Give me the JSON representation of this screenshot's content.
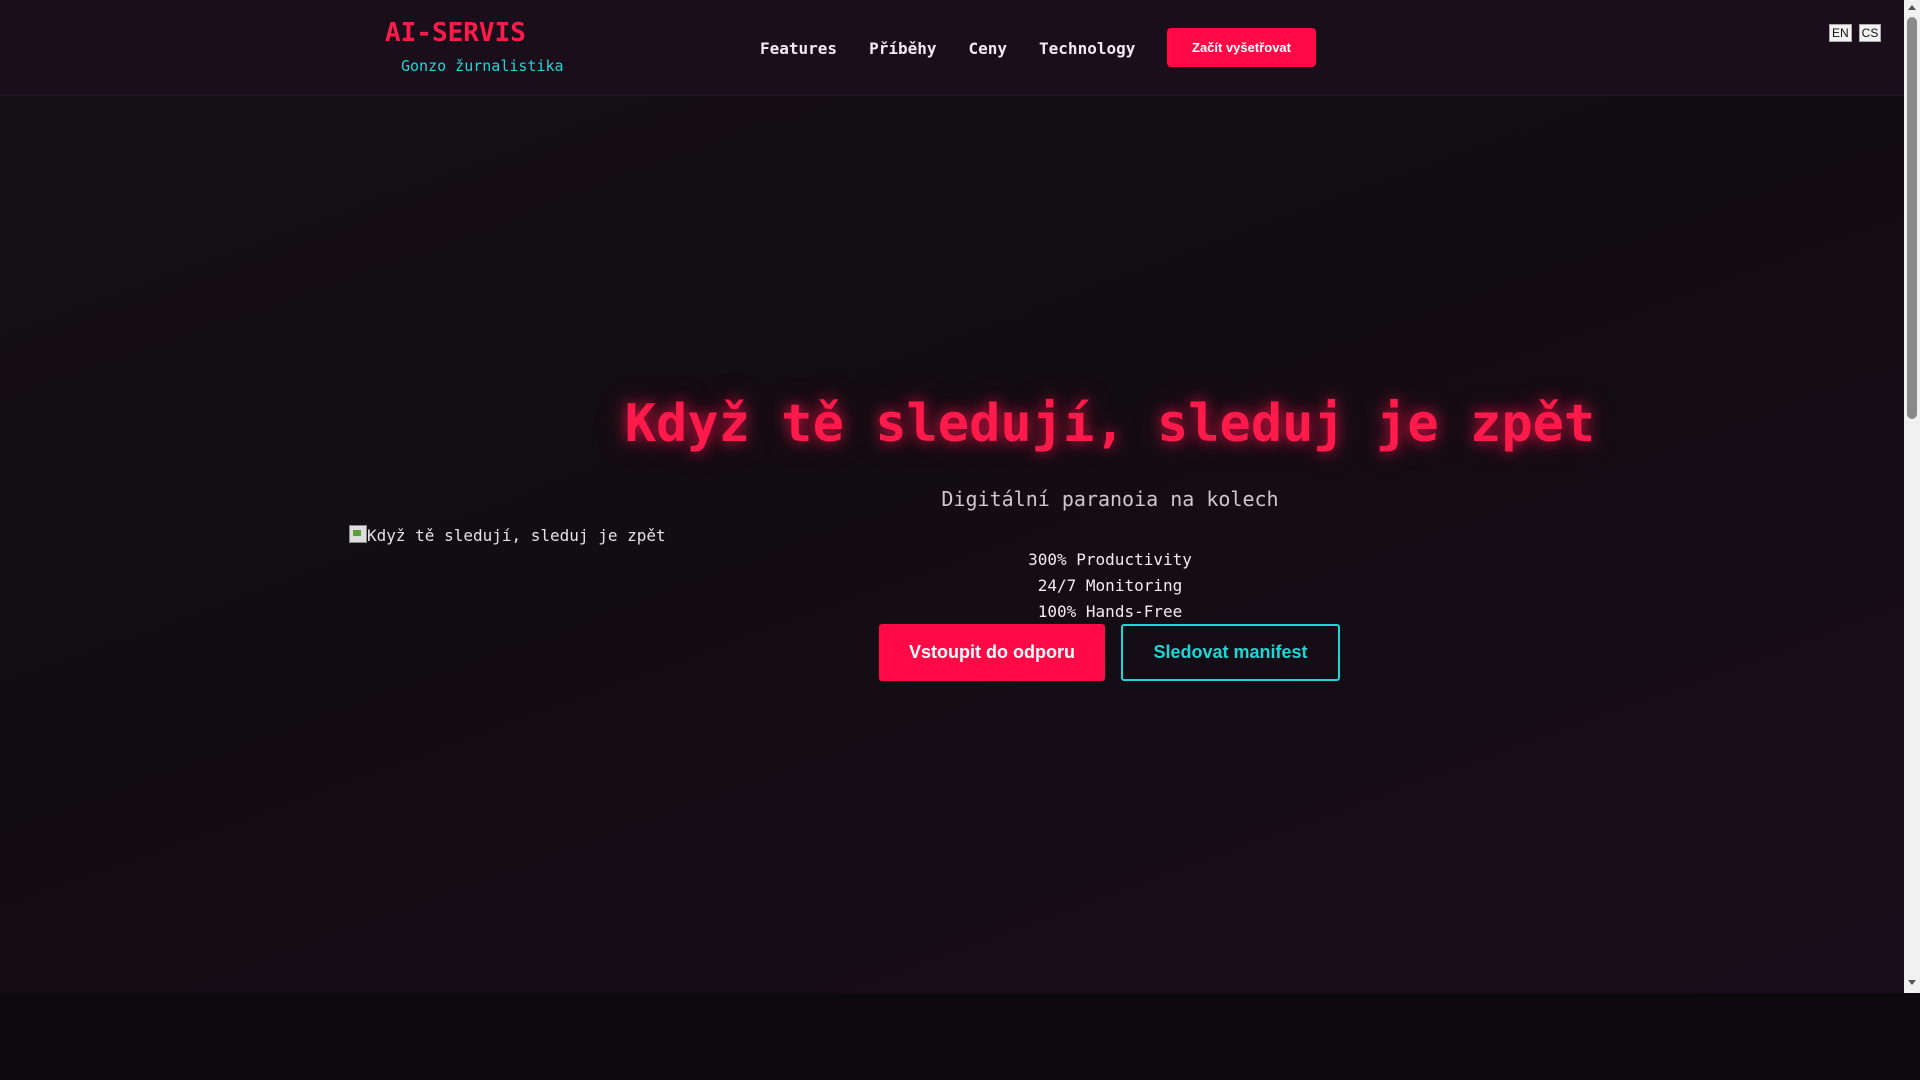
{
  "header": {
    "brand": "AI-SERVIS",
    "tagline": "Gonzo žurnalistika",
    "nav": [
      {
        "label": "Features"
      },
      {
        "label": "Příběhy"
      },
      {
        "label": "Ceny"
      },
      {
        "label": "Technology"
      }
    ],
    "cta_label": "Začít vyšetřovat",
    "languages": [
      "EN",
      "CS"
    ]
  },
  "hero": {
    "image_alt": "Když tě sledují, sleduj je zpět",
    "title": "Když tě sledují, sleduj je zpět",
    "subtitle": "Digitální paranoia na kolech",
    "stats": [
      "300% Productivity",
      "24/7 Monitoring",
      "100% Hands-Free"
    ],
    "primary_button": "Vstoupit do odporu",
    "secondary_button": "Sledovat manifest"
  },
  "colors": {
    "accent": "#ff0a46",
    "secondary": "#1fd6d6",
    "background": "#120d12"
  }
}
